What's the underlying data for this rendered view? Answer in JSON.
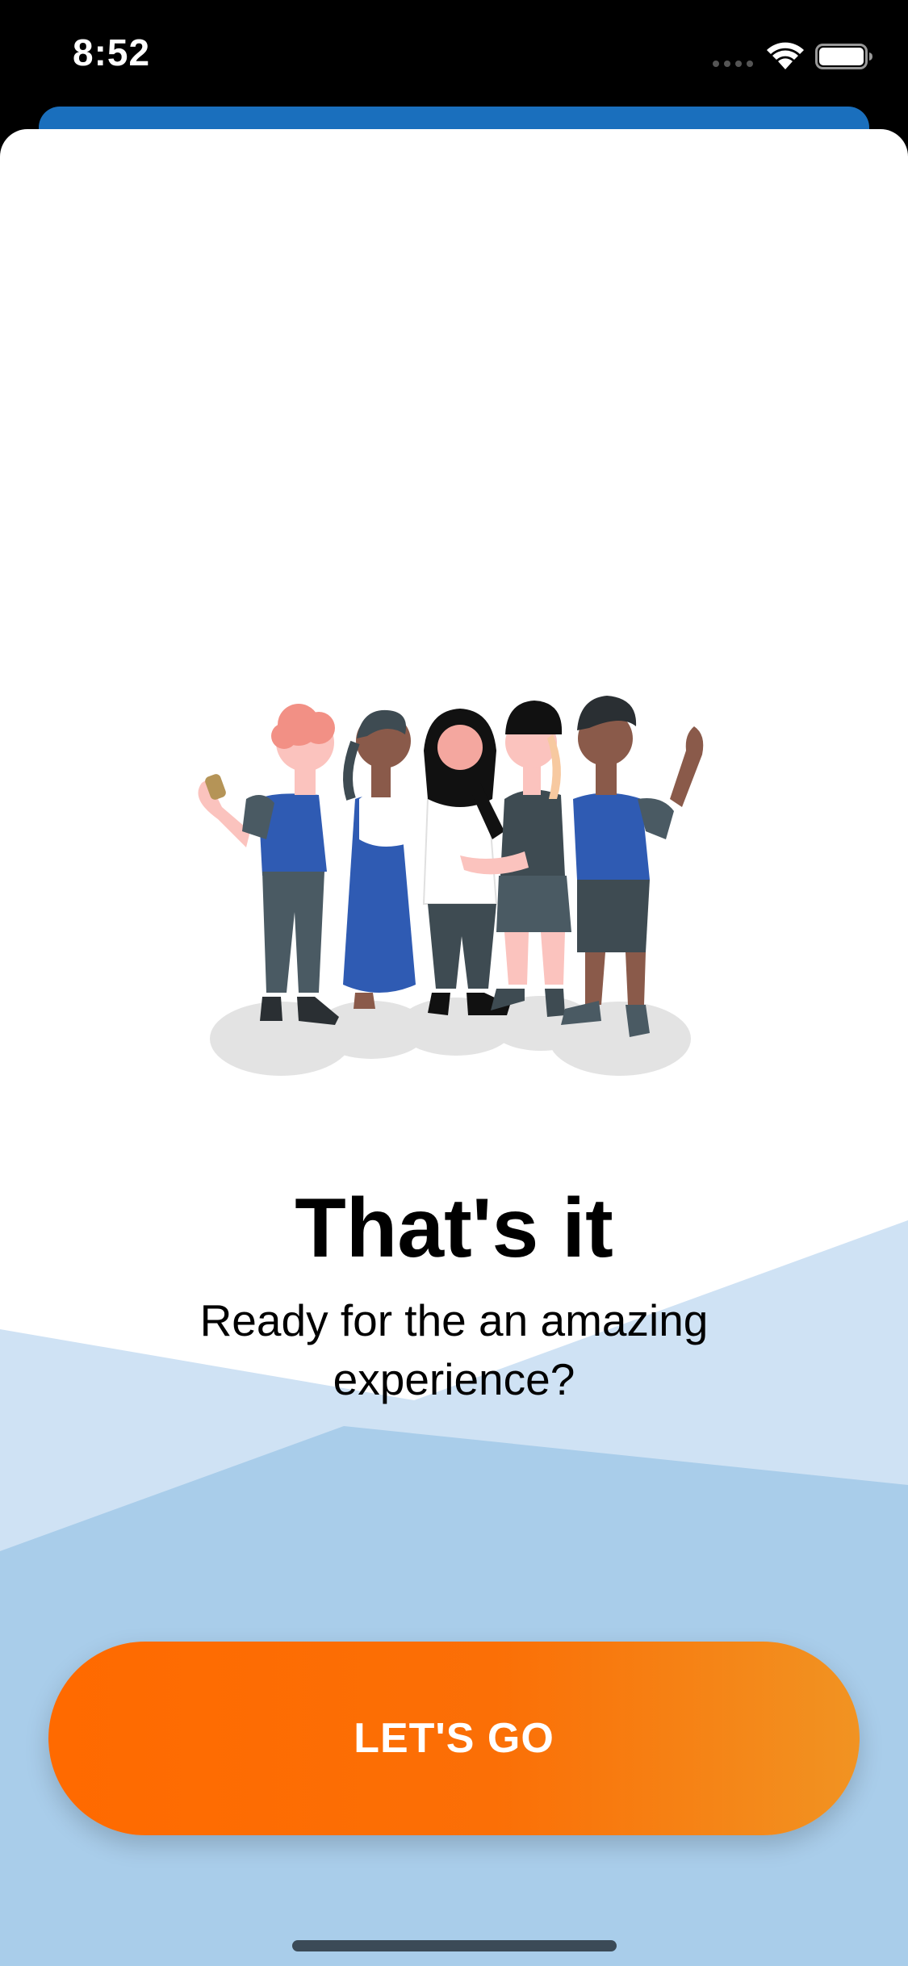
{
  "status_bar": {
    "time": "8:52",
    "icons": [
      "cellular-signal-icon",
      "wifi-icon",
      "battery-icon"
    ]
  },
  "onboarding": {
    "illustration": "group-of-friends-illustration",
    "title": "That's it",
    "subtitle": "Ready for the an amazing experience?",
    "cta_label": "LET'S GO"
  },
  "colors": {
    "background": "#000000",
    "sheet": "#ffffff",
    "header_blue": "#1a6fbd",
    "wave_light": "#cfe2f4",
    "wave_mid": "#a9cdea",
    "button_start": "#ff6a00",
    "button_end": "#f19322",
    "text": "#000000"
  }
}
